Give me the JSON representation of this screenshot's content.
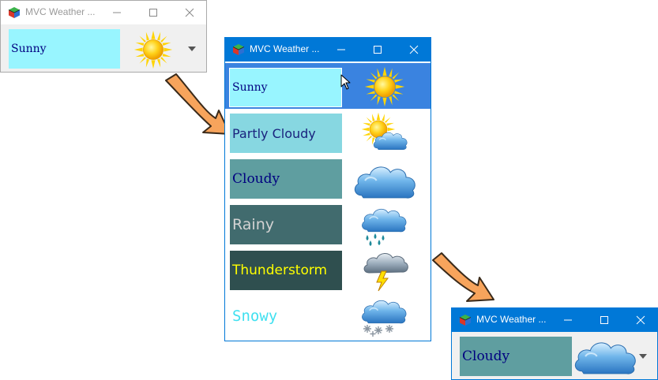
{
  "window_title": "MVC Weather ...",
  "colors": {
    "title_active": "#0078d7",
    "selection": "#3a83e0",
    "sunny_bg": "#98f5ff",
    "partly_cloudy_bg": "#87d7e1",
    "cloudy_bg": "#5f9ea0",
    "rainy_bg": "#416b6e",
    "thunder_bg": "#2f4f4f",
    "arrow": "#f7a45c"
  },
  "windows": {
    "top_left": {
      "selected": "Sunny",
      "icon": "sun-icon",
      "state": "inactive"
    },
    "dropdown": {
      "state": "active",
      "items": [
        {
          "label": "Sunny",
          "icon": "sun-icon",
          "selected": true
        },
        {
          "label": "Partly Cloudy",
          "icon": "partly-cloudy-icon"
        },
        {
          "label": "Cloudy",
          "icon": "cloud-icon"
        },
        {
          "label": "Rainy",
          "icon": "rain-icon"
        },
        {
          "label": "Thunderstorm",
          "icon": "thunderstorm-icon"
        },
        {
          "label": "Snowy",
          "icon": "snow-icon"
        }
      ]
    },
    "bottom_right": {
      "selected": "Cloudy",
      "icon": "cloud-icon",
      "state": "active"
    }
  }
}
